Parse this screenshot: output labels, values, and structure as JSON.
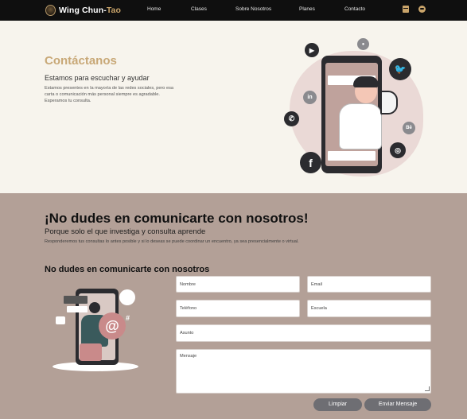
{
  "navbar": {
    "brand_main": "Wing Chun-",
    "brand_accent": "Tao",
    "links": [
      "Home",
      "Clases",
      "Sobre Nosotros",
      "Planes",
      "Contacto"
    ],
    "icons": [
      "calendar-icon",
      "user-icon"
    ]
  },
  "hero": {
    "title": "Contáctanos",
    "subtitle": "Estamos para escuchar y ayudar",
    "text": "Estamos presentes en la mayoría de las redes sociales, pero esa carta o comunicación más personal siempre es agradable. Esperamos tu consulta."
  },
  "illustration": {
    "social_icons": [
      "youtube-icon",
      "user-icon",
      "twitter-icon",
      "linkedin-icon",
      "whatsapp-icon",
      "behance-icon",
      "instagram-icon",
      "facebook-icon"
    ],
    "labels": {
      "youtube": "▶",
      "user": "●",
      "twitter": "🐦",
      "linkedin": "in",
      "whatsapp": "✆",
      "behance": "Bē",
      "instagram": "◎",
      "facebook": "f"
    }
  },
  "contact": {
    "title": "¡No dudes en comunicarte con nosotros!",
    "subtitle": "Porque solo el que investiga y consulta aprende",
    "text": "Responderemos tus consultas lo antes posible y si lo deseas se puede coordinar un encuentro, ya sea presencialmente o virtual.",
    "form_heading": "No dudes en comunicarte con nosotros"
  },
  "form": {
    "name_placeholder": "Nombre",
    "email_placeholder": "Email",
    "phone_placeholder": "Teléfono",
    "school_placeholder": "Escuela",
    "subject_placeholder": "Asunto",
    "message_placeholder": "Mensaje",
    "clear_label": "Limpiar",
    "send_label": "Enviar Mensaje"
  },
  "colors": {
    "navbar_bg": "#0f0f0f",
    "accent_gold": "#c9a46a",
    "hero_bg": "#f7f4ed",
    "section_bg": "#b3a097",
    "button_bg": "#6e6e73"
  }
}
